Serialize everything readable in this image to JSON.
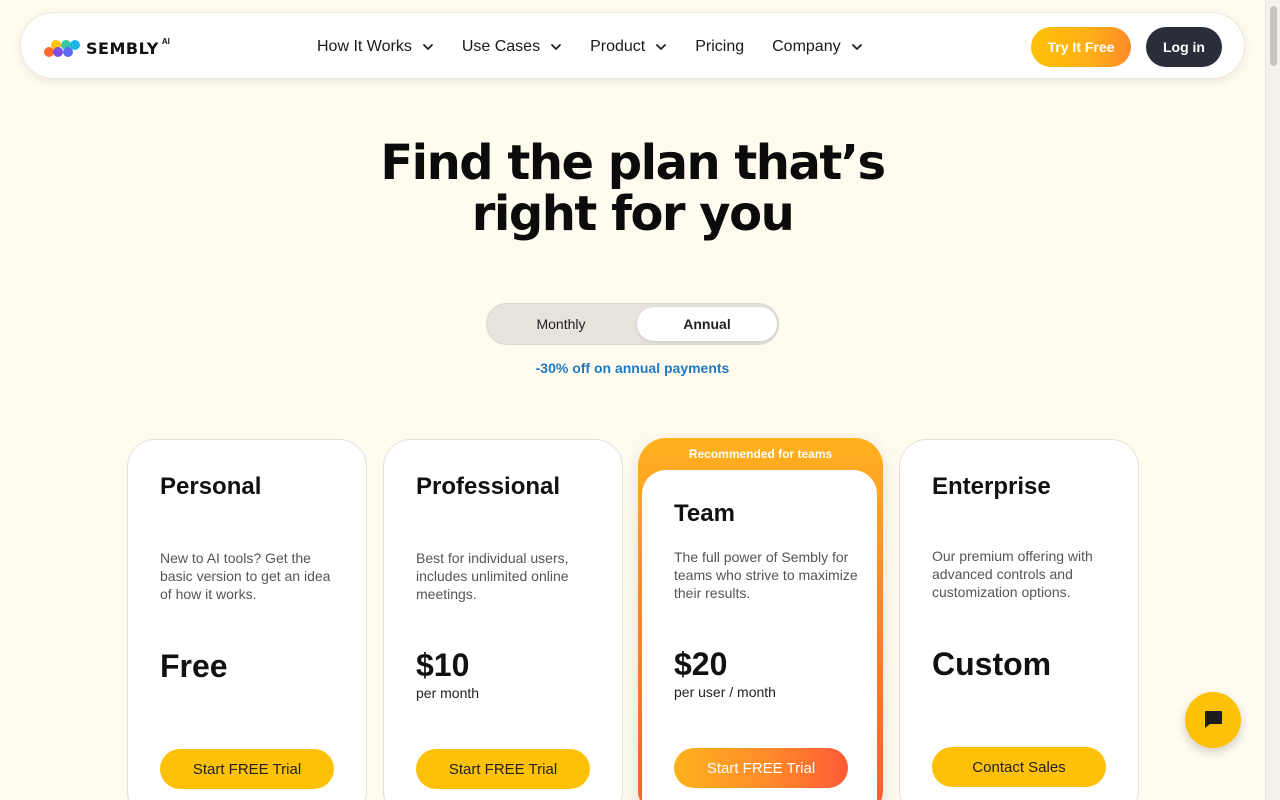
{
  "brand": {
    "name": "SEMBLY",
    "suffix": "AI"
  },
  "nav": {
    "items": [
      {
        "label": "How It Works",
        "has_dropdown": true
      },
      {
        "label": "Use Cases",
        "has_dropdown": true
      },
      {
        "label": "Product",
        "has_dropdown": true
      },
      {
        "label": "Pricing",
        "has_dropdown": false
      },
      {
        "label": "Company",
        "has_dropdown": true
      }
    ],
    "try_label": "Try It Free",
    "login_label": "Log in"
  },
  "hero": {
    "line1": "Find the plan that’s",
    "line2": "right for you"
  },
  "billing": {
    "monthly": "Monthly",
    "annual": "Annual",
    "selected": "Annual",
    "discount": "-30% off on annual payments"
  },
  "plans": [
    {
      "name": "Personal",
      "description": "New to AI tools? Get the basic version to get an idea of how it works.",
      "price": "Free",
      "period": "",
      "cta": "Start FREE Trial"
    },
    {
      "name": "Professional",
      "description": "Best for individual users, includes unlimited online meetings.",
      "price": "$10",
      "period": "per month",
      "cta": "Start FREE Trial"
    },
    {
      "name": "Team",
      "badge": "Recommended for teams",
      "description": "The full power of Sembly for teams who strive to maximize their results.",
      "price": "$20",
      "period": "per user / month",
      "cta": "Start FREE Trial"
    },
    {
      "name": "Enterprise",
      "description": "Our premium offering with advanced controls and customization options.",
      "price": "Custom",
      "period": "",
      "cta": "Contact Sales"
    }
  ],
  "colors": {
    "accent": "#ffc107",
    "gradient_end": "#ff5a33",
    "dark_button": "#2b2d3a",
    "link_blue": "#1f7ac6",
    "page_bg": "#fffbef"
  },
  "icons": {
    "chat": "chat-bubble-icon",
    "dropdown": "chevron-down-icon"
  }
}
